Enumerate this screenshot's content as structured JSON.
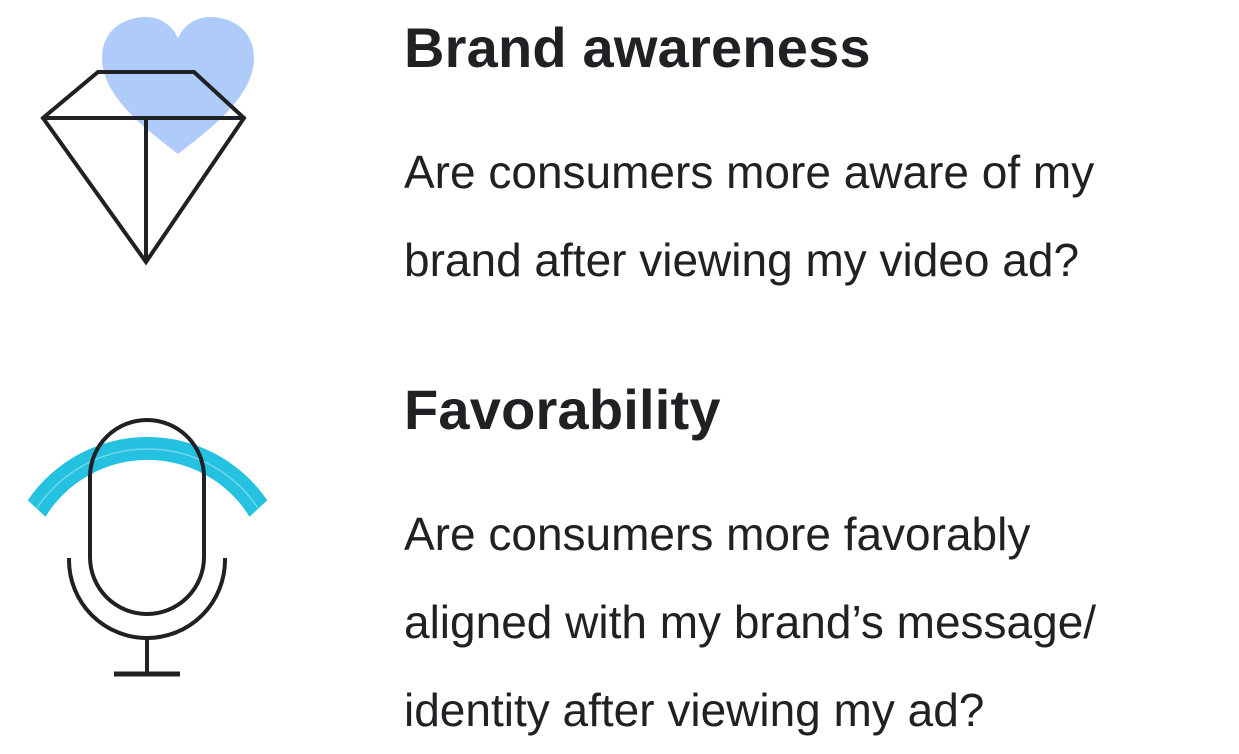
{
  "sections": [
    {
      "icon": "diamond-with-heart-icon",
      "title": "Brand awareness",
      "lines": [
        "Are consumers more aware of my",
        "brand after viewing my video ad?"
      ]
    },
    {
      "icon": "microphone-with-arc-icon",
      "title": "Favorability",
      "lines": [
        "Are consumers more favorably",
        "aligned with my brand’s message/",
        "identity after viewing my ad?"
      ]
    }
  ],
  "colors": {
    "text": "#202124",
    "heart": "#aecbfa",
    "arc": "#24c1e0",
    "stroke": "#202124"
  }
}
